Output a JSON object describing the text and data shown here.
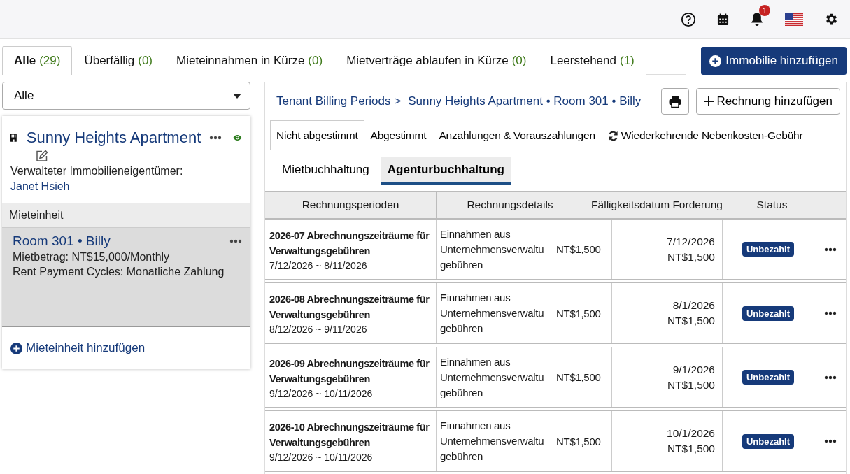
{
  "top_bar": {
    "notification_count": "1"
  },
  "tabs": [
    {
      "label": "Alle",
      "count": "(29)",
      "selected": true
    },
    {
      "label": "Überfällig",
      "count": "(0)",
      "selected": false
    },
    {
      "label": "Mieteinnahmen in Kürze",
      "count": "(0)",
      "selected": false
    },
    {
      "label": "Mietverträge ablaufen in Kürze",
      "count": "(0)",
      "selected": false
    },
    {
      "label": "Leerstehend",
      "count": "(1)",
      "selected": false
    }
  ],
  "add_property_button": "Immobilie hinzufügen",
  "filter_dropdown": {
    "value": "Alle"
  },
  "property": {
    "name": "Sunny Heights Apartment",
    "visible": true,
    "owner_label": "Verwalteter Immobilieneigentümer:",
    "owner_name": "Janet Hsieh",
    "units_header": "Mieteinheit",
    "units": [
      {
        "title": "Room 301 • Billy",
        "rent": "Mietbetrag: NT$15,000/Monthly",
        "cycle": "Rent Payment Cycles: Monatliche Zahlung",
        "selected": true
      }
    ],
    "add_unit_button": "Mieteinheit hinzufügen"
  },
  "breadcrumb": {
    "root": "Tenant Billing Periods >",
    "current": "Sunny Heights Apartment • Room 301 • Billy"
  },
  "add_invoice_button": "Rechnung hinzufügen",
  "billing_tabs": [
    {
      "label": "Nicht abgestimmt",
      "selected": true,
      "kind": "plain"
    },
    {
      "label": "Abgestimmt",
      "selected": false,
      "kind": "plain"
    },
    {
      "label": "Anzahlungen & Vorauszahlungen",
      "selected": false,
      "kind": "plain"
    },
    {
      "label": "Wiederkehrende Nebenkosten-Gebühr",
      "selected": false,
      "kind": "recurring"
    }
  ],
  "sub_tabs": [
    {
      "label": "Mietbuchhaltung",
      "selected": false
    },
    {
      "label": "Agenturbuchhaltung",
      "selected": true
    }
  ],
  "table": {
    "columns": [
      "Rechnungsperioden",
      "Rechnungsdetails",
      "Fälligkeitsdatum Forderung",
      "Status"
    ],
    "rows": [
      {
        "period": "2026-07 Abrechnungszeiträume für Verwaltungsgebühren",
        "range": "7/12/2026 ~ 8/11/2026",
        "detail": "Einnahmen aus Unternehmensverwaltu gebühren",
        "amount": "NT$1,500",
        "due_date": "7/12/2026",
        "due_amount": "NT$1,500",
        "status": "Unbezahlt"
      },
      {
        "period": "2026-08 Abrechnungszeiträume für Verwaltungsgebühren",
        "range": "8/12/2026 ~ 9/11/2026",
        "detail": "Einnahmen aus Unternehmensverwaltu gebühren",
        "amount": "NT$1,500",
        "due_date": "8/1/2026",
        "due_amount": "NT$1,500",
        "status": "Unbezahlt"
      },
      {
        "period": "2026-09 Abrechnungszeiträume für Verwaltungsgebühren",
        "range": "9/12/2026 ~ 10/11/2026",
        "detail": "Einnahmen aus Unternehmensverwaltu gebühren",
        "amount": "NT$1,500",
        "due_date": "9/1/2026",
        "due_amount": "NT$1,500",
        "status": "Unbezahlt"
      },
      {
        "period": "2026-10 Abrechnungszeiträume für Verwaltungsgebühren",
        "range": "9/12/2026 ~ 10/11/2026",
        "detail": "Einnahmen aus Unternehmensverwaltu gebühren",
        "amount": "NT$1,500",
        "due_date": "10/1/2026",
        "due_amount": "NT$1,500",
        "status": "Unbezahlt"
      }
    ]
  }
}
